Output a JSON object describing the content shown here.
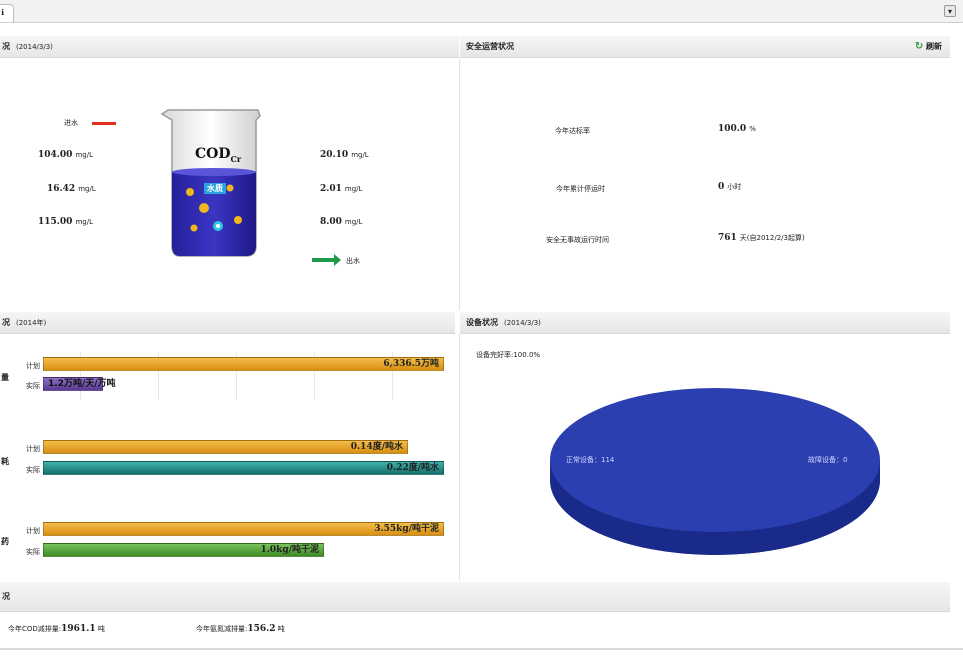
{
  "tab": {
    "label": "ℹ"
  },
  "panels": {
    "top_left": {
      "title": "况",
      "date": "(2014/3/3)"
    },
    "top_right": {
      "title": "安全运营状况",
      "refresh_label": "刷新"
    },
    "mid_left": {
      "title": "况",
      "date": "(2014年)"
    },
    "mid_right": {
      "title": "设备状况",
      "date": "(2014/3/3)"
    },
    "bottom": {
      "title": "况"
    }
  },
  "cod": {
    "legend_in_label": "进水",
    "legend_out_label": "出水",
    "beaker_label": "COD",
    "beaker_sub": "Cr",
    "beaker_tag": "水质",
    "in_values": [
      {
        "value": "104.00",
        "unit": "mg/L"
      },
      {
        "value": "16.42",
        "unit": "mg/L"
      },
      {
        "value": "115.00",
        "unit": "mg/L"
      }
    ],
    "out_values": [
      {
        "value": "20.10",
        "unit": "mg/L"
      },
      {
        "value": "2.01",
        "unit": "mg/L"
      },
      {
        "value": "8.00",
        "unit": "mg/L"
      }
    ]
  },
  "safety": {
    "rows": [
      {
        "label": "今年达标率",
        "value": "100.0",
        "unit": "%"
      },
      {
        "label": "今年累计停运时",
        "value": "0",
        "unit": "小时"
      },
      {
        "label": "安全无事故运行时间",
        "value": "761",
        "unit": "天(自2012/2/3起算)"
      }
    ]
  },
  "bars": {
    "plan_label": "计划",
    "actual_label": "实际",
    "groups": [
      {
        "row_label": "量",
        "plan_text": "6,336.5万吨",
        "actual_text": "1.2万吨/天/万吨"
      },
      {
        "row_label": "耗",
        "plan_text": "0.14度/吨水",
        "actual_text": "0.22度/吨水"
      },
      {
        "row_label": "药",
        "plan_text": "3.55kg/吨干泥",
        "actual_text": "1.0kg/吨干泥"
      }
    ]
  },
  "equipment": {
    "rate_text": "设备完好率:100.0%",
    "normal_label": "正常设备：114",
    "fault_label": "故障设备：0"
  },
  "summary": {
    "cod_label": "今年COD减排量:",
    "cod_value": "1961.1",
    "cod_unit": "吨",
    "nh_label": "今年氨氮减排量:",
    "nh_value": "156.2",
    "nh_unit": "吨"
  },
  "chart_data": [
    {
      "type": "bar",
      "categories": [
        "量",
        "耗",
        "药"
      ],
      "series": [
        {
          "name": "计划",
          "values": [
            1.0,
            0.91,
            1.0
          ]
        },
        {
          "name": "实际",
          "values": [
            0.15,
            1.0,
            0.7
          ]
        }
      ],
      "value_labels": {
        "计划": [
          "6,336.5万吨",
          "0.14度/吨水",
          "3.55kg/吨干泥"
        ],
        "实际": [
          "1.2万吨/天/万吨",
          "0.22度/吨水",
          "1.0kg/吨干泥"
        ]
      }
    },
    {
      "type": "pie",
      "slices": [
        {
          "label": "正常设备：114",
          "value": 114
        },
        {
          "label": "故障设备：0",
          "value": 0
        }
      ]
    }
  ],
  "colors": {
    "accent_blue": "#2b3fa8",
    "bar_plan": "#e8a21c",
    "bar_actual_1": "#6a4aa3",
    "bar_actual_2": "#1f8c85",
    "bar_actual_3": "#5aa83a",
    "legend_in": "#e0301e",
    "legend_out": "#1f9a4a"
  }
}
